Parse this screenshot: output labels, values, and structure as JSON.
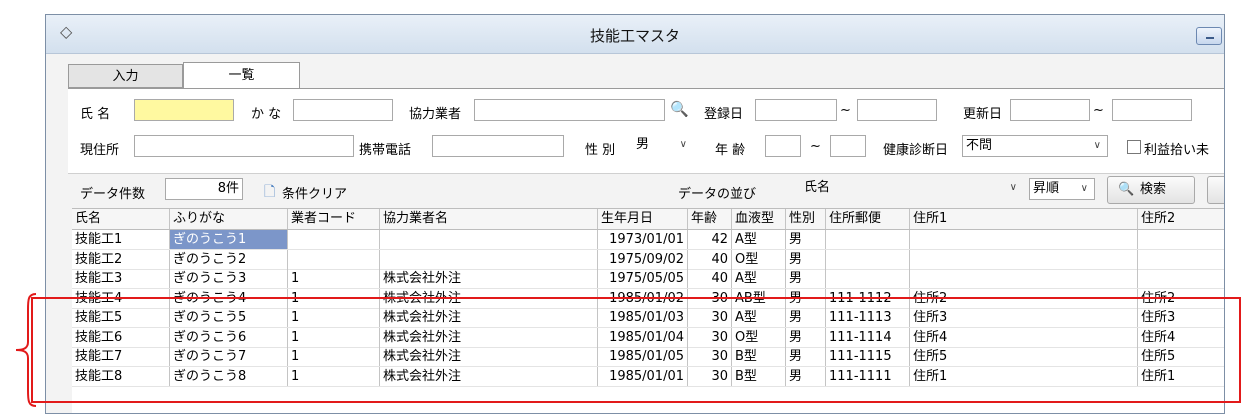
{
  "window": {
    "title": "技能工マスタ"
  },
  "tabs": [
    {
      "label": "入力"
    },
    {
      "label": "一覧"
    }
  ],
  "search": {
    "name_label": "氏 名",
    "name_value": "",
    "kana_label": "か な",
    "kana_value": "",
    "partner_label": "協力業者",
    "partner_value": "",
    "reg_date_label": "登録日",
    "tilde": "~",
    "upd_date_label": "更新日",
    "address_label": "現住所",
    "mobile_label": "携帯電話",
    "gender_label": "性 別",
    "gender_value": "男",
    "age_label": "年 齢",
    "health_label": "健康診断日",
    "health_value": "不問",
    "profit_label": "利益拾い未"
  },
  "toolbar": {
    "count_label": "データ件数",
    "count_value": "8件",
    "clear_label": "条件クリア",
    "sort_label": "データの並び",
    "sort_value": "氏名",
    "order_value": "昇順",
    "search_label": "検索"
  },
  "table": {
    "headers": [
      "氏名",
      "ふりがな",
      "業者コード",
      "協力業者名",
      "生年月日",
      "年齢",
      "血液型",
      "性別",
      "住所郵便",
      "住所1",
      "住所2"
    ],
    "rows": [
      [
        "技能工1",
        "ぎのうこう1",
        "",
        "",
        "1973/01/01",
        "42",
        "A型",
        "男",
        "",
        "",
        ""
      ],
      [
        "技能工2",
        "ぎのうこう2",
        "",
        "",
        "1975/09/02",
        "40",
        "O型",
        "男",
        "",
        "",
        ""
      ],
      [
        "技能工3",
        "ぎのうこう3",
        "1",
        "株式会社外注",
        "1975/05/05",
        "40",
        "A型",
        "男",
        "",
        "",
        ""
      ],
      [
        "技能工4",
        "ぎのうこう4",
        "1",
        "株式会社外注",
        "1985/01/02",
        "30",
        "AB型",
        "男",
        "111-1112",
        "住所2",
        "住所2"
      ],
      [
        "技能工5",
        "ぎのうこう5",
        "1",
        "株式会社外注",
        "1985/01/03",
        "30",
        "A型",
        "男",
        "111-1113",
        "住所3",
        "住所3"
      ],
      [
        "技能工6",
        "ぎのうこう6",
        "1",
        "株式会社外注",
        "1985/01/04",
        "30",
        "O型",
        "男",
        "111-1114",
        "住所4",
        "住所4"
      ],
      [
        "技能工7",
        "ぎのうこう7",
        "1",
        "株式会社外注",
        "1985/01/05",
        "30",
        "B型",
        "男",
        "111-1115",
        "住所5",
        "住所5"
      ],
      [
        "技能工8",
        "ぎのうこう8",
        "1",
        "株式会社外注",
        "1985/01/01",
        "30",
        "B型",
        "男",
        "111-1111",
        "住所1",
        "住所1"
      ]
    ]
  },
  "colors": {
    "highlight": "#e21a1a",
    "selection": "#7c96c9",
    "name_field": "#fff9a0"
  }
}
